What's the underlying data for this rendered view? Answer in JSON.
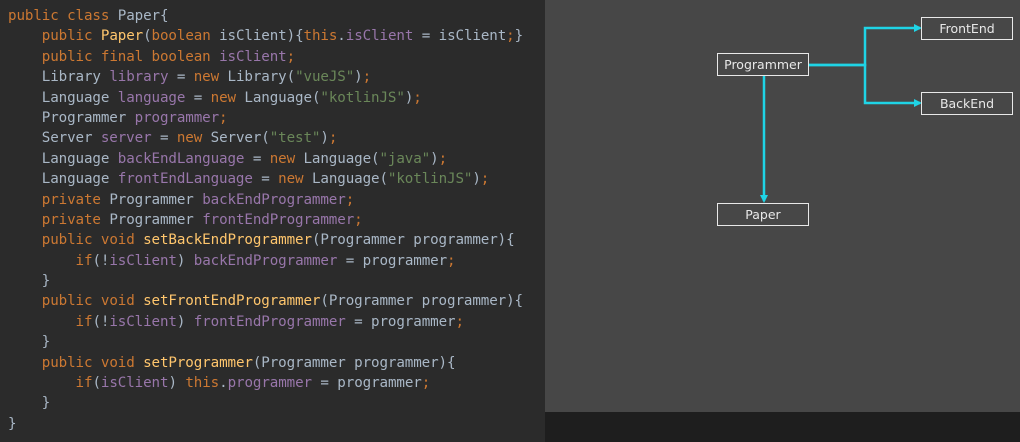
{
  "code": {
    "lines": [
      [
        [
          "kw",
          "public class "
        ],
        [
          "plain",
          "Paper{"
        ]
      ],
      [
        [
          "plain",
          "    "
        ],
        [
          "kw",
          "public "
        ],
        [
          "method",
          "Paper"
        ],
        [
          "plain",
          "("
        ],
        [
          "kw",
          "boolean "
        ],
        [
          "plain",
          "isClient){"
        ],
        [
          "kw",
          "this"
        ],
        [
          "plain",
          "."
        ],
        [
          "field",
          "isClient"
        ],
        [
          "plain",
          " = isClient"
        ],
        [
          "kw",
          ";"
        ],
        [
          "plain",
          "}"
        ]
      ],
      [
        [
          "plain",
          "    "
        ],
        [
          "kw",
          "public final boolean "
        ],
        [
          "field",
          "isClient"
        ],
        [
          "kw",
          ";"
        ]
      ],
      [
        [
          "plain",
          "    Library "
        ],
        [
          "field",
          "library"
        ],
        [
          "plain",
          " = "
        ],
        [
          "kw",
          "new "
        ],
        [
          "plain",
          "Library("
        ],
        [
          "string",
          "\"vueJS\""
        ],
        [
          "plain",
          ")"
        ],
        [
          "kw",
          ";"
        ]
      ],
      [
        [
          "plain",
          "    Language "
        ],
        [
          "field",
          "language"
        ],
        [
          "plain",
          " = "
        ],
        [
          "kw",
          "new "
        ],
        [
          "plain",
          "Language("
        ],
        [
          "string",
          "\"kotlinJS\""
        ],
        [
          "plain",
          ")"
        ],
        [
          "kw",
          ";"
        ]
      ],
      [
        [
          "plain",
          "    Programmer "
        ],
        [
          "field",
          "programmer"
        ],
        [
          "kw",
          ";"
        ]
      ],
      [
        [
          "plain",
          "    Server "
        ],
        [
          "field",
          "server"
        ],
        [
          "plain",
          " = "
        ],
        [
          "kw",
          "new "
        ],
        [
          "plain",
          "Server("
        ],
        [
          "string",
          "\"test\""
        ],
        [
          "plain",
          ")"
        ],
        [
          "kw",
          ";"
        ]
      ],
      [
        [
          "plain",
          "    Language "
        ],
        [
          "field",
          "backEndLanguage"
        ],
        [
          "plain",
          " = "
        ],
        [
          "kw",
          "new "
        ],
        [
          "plain",
          "Language("
        ],
        [
          "string",
          "\"java\""
        ],
        [
          "plain",
          ")"
        ],
        [
          "kw",
          ";"
        ]
      ],
      [
        [
          "plain",
          "    Language "
        ],
        [
          "field",
          "frontEndLanguage"
        ],
        [
          "plain",
          " = "
        ],
        [
          "kw",
          "new "
        ],
        [
          "plain",
          "Language("
        ],
        [
          "string",
          "\"kotlinJS\""
        ],
        [
          "plain",
          ")"
        ],
        [
          "kw",
          ";"
        ]
      ],
      [
        [
          "plain",
          "    "
        ],
        [
          "kw",
          "private "
        ],
        [
          "plain",
          "Programmer "
        ],
        [
          "field",
          "backEndProgrammer"
        ],
        [
          "kw",
          ";"
        ]
      ],
      [
        [
          "plain",
          "    "
        ],
        [
          "kw",
          "private "
        ],
        [
          "plain",
          "Programmer "
        ],
        [
          "field",
          "frontEndProgrammer"
        ],
        [
          "kw",
          ";"
        ]
      ],
      [
        [
          "plain",
          "    "
        ],
        [
          "kw",
          "public void "
        ],
        [
          "method",
          "setBackEndProgrammer"
        ],
        [
          "plain",
          "(Programmer programmer){"
        ]
      ],
      [
        [
          "plain",
          "        "
        ],
        [
          "kw",
          "if"
        ],
        [
          "plain",
          "(!"
        ],
        [
          "field",
          "isClient"
        ],
        [
          "plain",
          ") "
        ],
        [
          "field",
          "backEndProgrammer"
        ],
        [
          "plain",
          " = programmer"
        ],
        [
          "kw",
          ";"
        ]
      ],
      [
        [
          "plain",
          "    }"
        ]
      ],
      [
        [
          "plain",
          "    "
        ],
        [
          "kw",
          "public void "
        ],
        [
          "method",
          "setFrontEndProgrammer"
        ],
        [
          "plain",
          "(Programmer programmer){"
        ]
      ],
      [
        [
          "plain",
          "        "
        ],
        [
          "kw",
          "if"
        ],
        [
          "plain",
          "(!"
        ],
        [
          "field",
          "isClient"
        ],
        [
          "plain",
          ") "
        ],
        [
          "field",
          "frontEndProgrammer"
        ],
        [
          "plain",
          " = programmer"
        ],
        [
          "kw",
          ";"
        ]
      ],
      [
        [
          "plain",
          "    }"
        ]
      ],
      [
        [
          "plain",
          "    "
        ],
        [
          "kw",
          "public void "
        ],
        [
          "method",
          "setProgrammer"
        ],
        [
          "plain",
          "(Programmer programmer){"
        ]
      ],
      [
        [
          "plain",
          "        "
        ],
        [
          "kw",
          "if"
        ],
        [
          "plain",
          "("
        ],
        [
          "field",
          "isClient"
        ],
        [
          "plain",
          ") "
        ],
        [
          "kw",
          "this"
        ],
        [
          "plain",
          "."
        ],
        [
          "field",
          "programmer"
        ],
        [
          "plain",
          " = programmer"
        ],
        [
          "kw",
          ";"
        ]
      ],
      [
        [
          "plain",
          "    }"
        ]
      ],
      [
        [
          "plain",
          "}"
        ]
      ]
    ]
  },
  "diagram": {
    "nodes": {
      "programmer": "Programmer",
      "frontend": "FrontEnd",
      "backend": "BackEnd",
      "paper": "Paper"
    },
    "edge_color": "#1fd4e6",
    "node_border_color": "#e8e8e8"
  }
}
